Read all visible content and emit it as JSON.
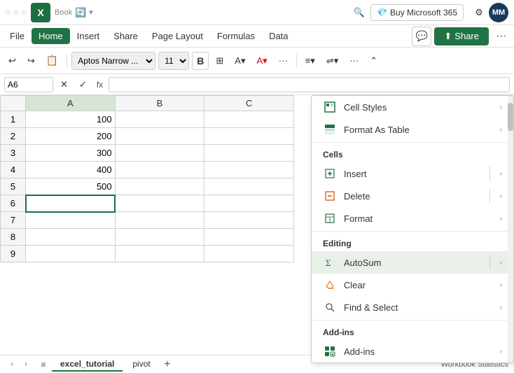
{
  "titlebar": {
    "app_icon": "X",
    "file_name": "Book",
    "autosave_icon": "🔄",
    "search_placeholder": "Search",
    "buy365_label": "Buy Microsoft 365",
    "gear_label": "⚙",
    "avatar_label": "MM"
  },
  "menubar": {
    "items": [
      "File",
      "Home",
      "Insert",
      "Share",
      "Page Layout",
      "Formulas",
      "Data"
    ],
    "active": "Home",
    "comment_icon": "💬",
    "share_label": "Share",
    "more_icon": "..."
  },
  "toolbar": {
    "undo_label": "↩",
    "redo_label": "↪",
    "format_painter": "🖌",
    "font_family": "Aptos Narrow ...",
    "font_size": "11",
    "bold_label": "B",
    "more_label": "..."
  },
  "formulabar": {
    "cell_ref": "A6",
    "fx_label": "fx"
  },
  "spreadsheet": {
    "col_headers": [
      "",
      "A",
      "B",
      "C"
    ],
    "rows": [
      {
        "num": 1,
        "a": "100",
        "b": "",
        "c": ""
      },
      {
        "num": 2,
        "a": "200",
        "b": "",
        "c": ""
      },
      {
        "num": 3,
        "a": "300",
        "b": "",
        "c": ""
      },
      {
        "num": 4,
        "a": "400",
        "b": "",
        "c": ""
      },
      {
        "num": 5,
        "a": "500",
        "b": "",
        "c": ""
      },
      {
        "num": 6,
        "a": "",
        "b": "",
        "c": ""
      },
      {
        "num": 7,
        "a": "",
        "b": "",
        "c": ""
      },
      {
        "num": 8,
        "a": "",
        "b": "",
        "c": ""
      },
      {
        "num": 9,
        "a": "",
        "b": "",
        "c": ""
      }
    ],
    "active_cell": "A6"
  },
  "dropdown": {
    "styles_section": {
      "cell_styles_label": "Cell Styles",
      "format_as_table_label": "Format As Table"
    },
    "cells_section": {
      "header": "Cells",
      "insert_label": "Insert",
      "delete_label": "Delete",
      "format_label": "Format"
    },
    "editing_section": {
      "header": "Editing",
      "autosum_label": "AutoSum",
      "clear_label": "Clear",
      "find_select_label": "Find & Select"
    },
    "addins_section": {
      "header": "Add-ins",
      "addins_label": "Add-ins"
    }
  },
  "bottombar": {
    "nav_left": "‹",
    "nav_right": "›",
    "sheets_menu": "≡",
    "tabs": [
      "excel_tutorial",
      "pivot"
    ],
    "active_tab": "excel_tutorial",
    "add_sheet": "+",
    "workbook_stats": "Workbook Statistics"
  },
  "colors": {
    "excel_green": "#217346",
    "active_cell_border": "#1d6f42",
    "col_a_bg": "#d6e4d6",
    "highlight_bg": "#e8f0e8"
  }
}
